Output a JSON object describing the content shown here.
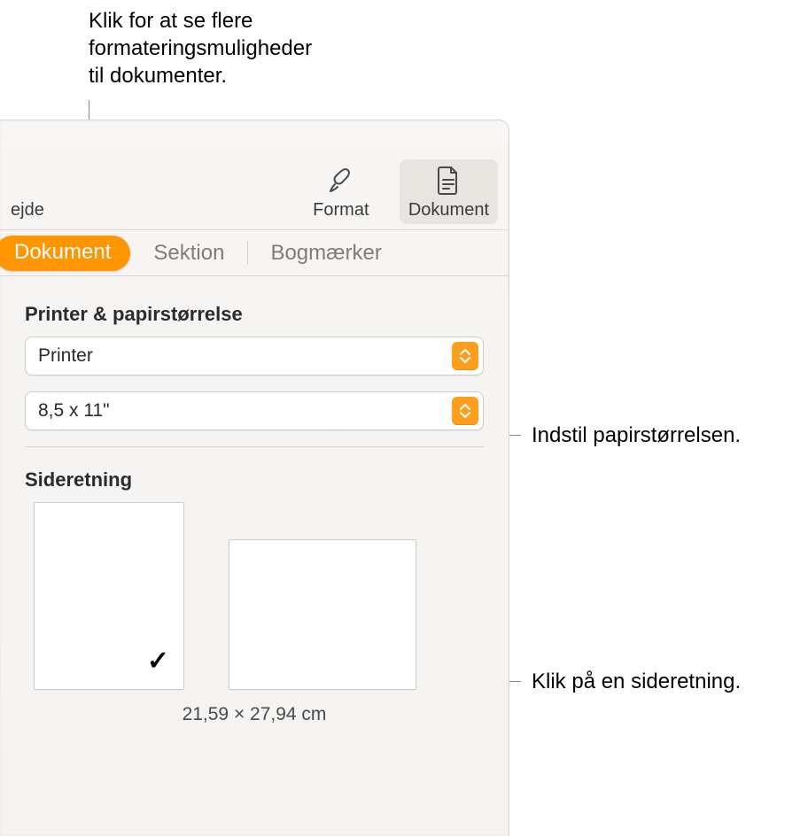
{
  "callouts": {
    "top": "Klik for at se flere\nformateringsmuligheder\ntil dokumenter.",
    "paper": "Indstil papirstørrelsen.",
    "orientation": "Klik på en sideretning."
  },
  "toolbar": {
    "left_stub": "ejde",
    "format_label": "Format",
    "document_label": "Dokument"
  },
  "subtabs": {
    "document": "Dokument",
    "section": "Sektion",
    "bookmarks": "Bogmærker"
  },
  "printer_section": {
    "title": "Printer & papirstørrelse",
    "printer_value": "Printer",
    "paper_value": "8,5 x 11\""
  },
  "orientation_section": {
    "title": "Sideretning",
    "size_label": "21,59 × 27,94 cm"
  }
}
